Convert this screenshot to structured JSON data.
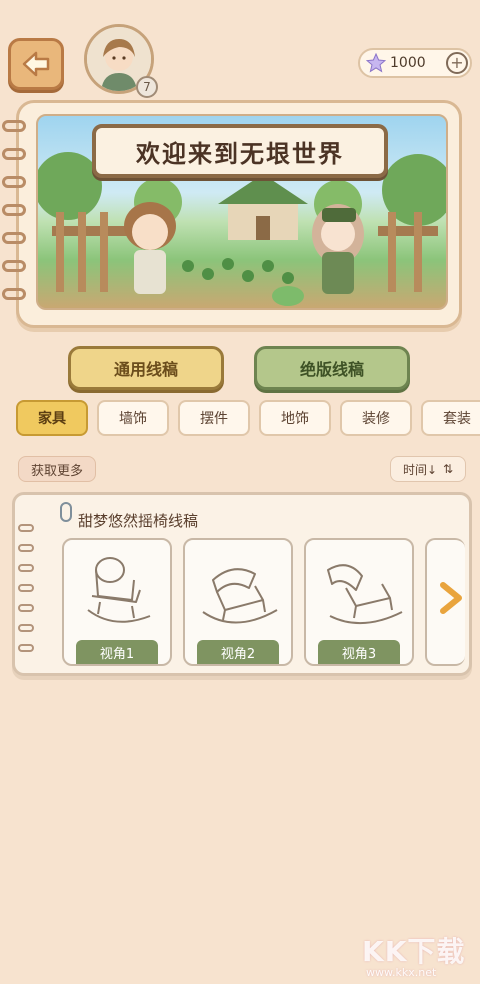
{
  "currency": {
    "amount": "1000",
    "plus": "+"
  },
  "player": {
    "level": "7"
  },
  "banner": {
    "title": "欢迎来到无垠世界"
  },
  "categories": {
    "general": "通用线稿",
    "limited": "绝版线稿"
  },
  "tabs": [
    "家具",
    "墙饰",
    "摆件",
    "地饰",
    "装修",
    "套装"
  ],
  "toolbar": {
    "more": "获取更多",
    "sort_label": "时间↓",
    "sort_icon": "⇅"
  },
  "item": {
    "title": "甜梦悠然摇椅线稿",
    "views": [
      "视角1",
      "视角2",
      "视角3"
    ]
  },
  "watermark": {
    "brand": "KK下载",
    "url": "www.kkx.net"
  },
  "colors": {
    "accent": "#f0c95f",
    "limited": "#b4c78b",
    "view_label": "#7f9461",
    "background": "#f7e3cf"
  }
}
